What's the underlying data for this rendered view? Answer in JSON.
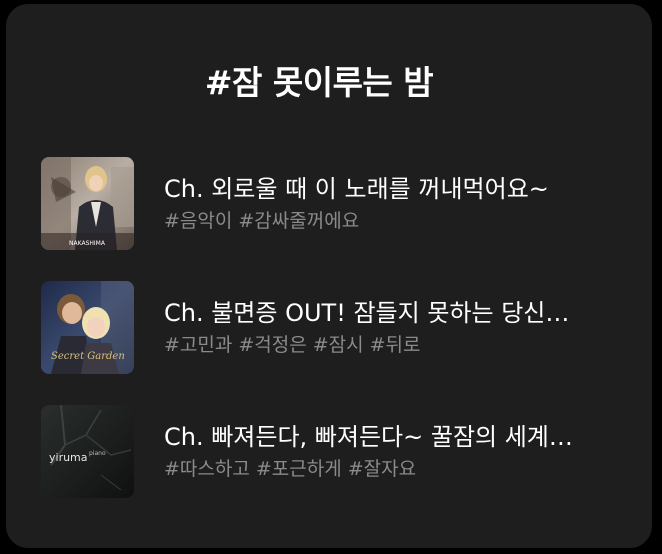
{
  "playlist": {
    "title": "#잠 못이루는 밤",
    "items": [
      {
        "title": "Ch. 외로울 때 이 노래를 꺼내먹어요~",
        "tags": [
          "#음악이",
          "#감싸줄꺼에요"
        ],
        "cover_text": "NAKASHIMA"
      },
      {
        "title": "Ch. 불면증 OUT! 잠들지 못하는 당신…",
        "tags": [
          "#고민과",
          "#걱정은",
          "#잠시",
          "#뒤로"
        ],
        "cover_text": "Secret Garden"
      },
      {
        "title": "Ch. 빠져든다, 빠져든다~ 꿀잠의 세계…",
        "tags": [
          "#따스하고",
          "#포근하게",
          "#잘자요"
        ],
        "cover_text": "yiruma",
        "cover_subtext": "piano"
      }
    ]
  },
  "colors": {
    "background": "#000000",
    "card": "#1e1e1e",
    "title_text": "#ffffff",
    "tag_text": "#8a8a8a"
  }
}
